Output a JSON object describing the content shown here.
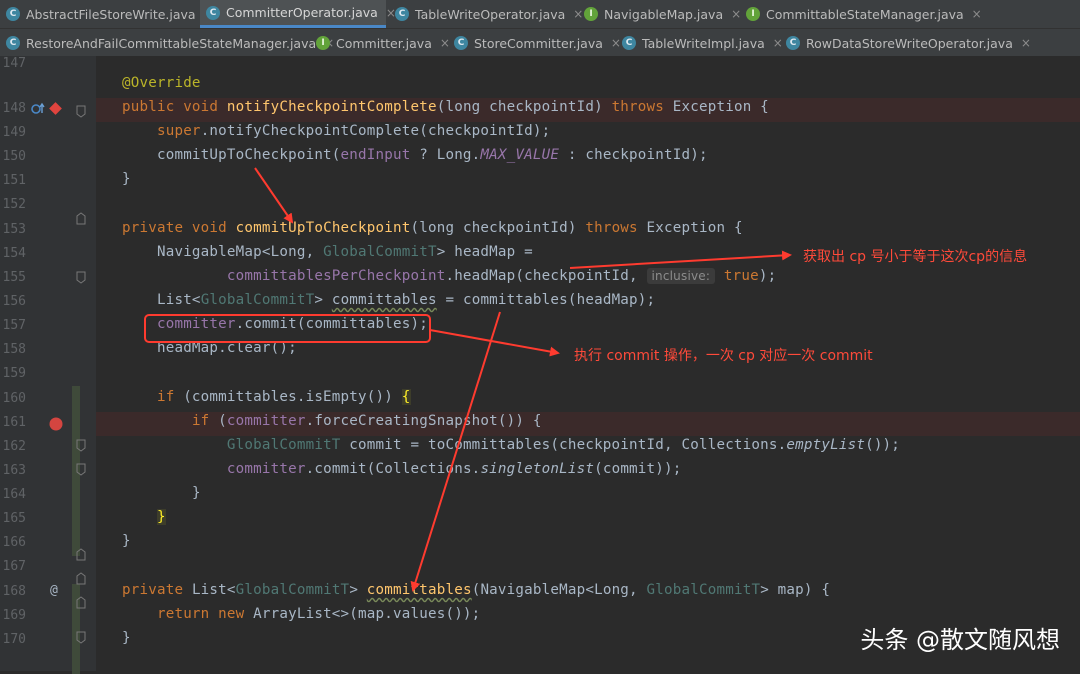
{
  "tabs_row1": [
    {
      "label": "AbstractFileStoreWrite.java",
      "icon": "c",
      "active": false
    },
    {
      "label": "CommitterOperator.java",
      "icon": "c",
      "active": true
    },
    {
      "label": "TableWriteOperator.java",
      "icon": "c",
      "active": false
    },
    {
      "label": "NavigableMap.java",
      "icon": "i",
      "active": false
    },
    {
      "label": "CommittableStateManager.java",
      "icon": "i",
      "active": false
    }
  ],
  "tabs_row2": [
    {
      "label": "RestoreAndFailCommittableStateManager.java",
      "icon": "c",
      "active": false
    },
    {
      "label": "Committer.java",
      "icon": "i",
      "active": false
    },
    {
      "label": "StoreCommitter.java",
      "icon": "c",
      "active": false
    },
    {
      "label": "TableWriteImpl.java",
      "icon": "c",
      "active": false
    },
    {
      "label": "RowDataStoreWriteOperator.java",
      "icon": "c",
      "active": false
    }
  ],
  "line_numbers": [
    "147",
    "148",
    "149",
    "150",
    "151",
    "152",
    "153",
    "154",
    "155",
    "156",
    "157",
    "158",
    "159",
    "160",
    "161",
    "162",
    "163",
    "164",
    "165",
    "166",
    "167",
    "168",
    "169",
    "170"
  ],
  "code": {
    "l147": "@Override",
    "l148": [
      "public void ",
      "notifyCheckpointComplete",
      "(long checkpointId) ",
      "throws",
      " Exception {"
    ],
    "l149": [
      "super",
      ".notifyCheckpointComplete(checkpointId);"
    ],
    "l150": [
      "commitUpToCheckpoint(",
      "endInput",
      " ? Long.",
      "MAX_VALUE",
      " : checkpointId);"
    ],
    "l151": "}",
    "l153": [
      "private void ",
      "commitUpToCheckpoint",
      "(long checkpointId) ",
      "throws",
      " Exception {"
    ],
    "l154": [
      "NavigableMap<Long, ",
      "GlobalCommitT",
      "> headMap ="
    ],
    "l155": [
      "committablesPerCheckpoint",
      ".headMap(checkpointId, ",
      "inclusive:",
      " true",
      ");"
    ],
    "l156": [
      "List<",
      "GlobalCommitT",
      "> ",
      "committables",
      " = committables(headMap);"
    ],
    "l157": [
      "committer",
      ".commit(committables);"
    ],
    "l158": "headMap.clear();",
    "l160": [
      "if",
      " (committables.isEmpty()) ",
      "{"
    ],
    "l161": [
      "if",
      " (",
      "committer",
      ".forceCreatingSnapshot()) {"
    ],
    "l162": [
      "GlobalCommitT",
      " commit = toCommittables(checkpointId, Collections.",
      "emptyList",
      "());"
    ],
    "l163": [
      "committer",
      ".commit(Collections.",
      "singletonList",
      "(commit));"
    ],
    "l164": "}",
    "l165": "}",
    "l166": "}",
    "l168": [
      "private ",
      "List<",
      "GlobalCommitT",
      "> ",
      "committables",
      "(NavigableMap<Long, ",
      "GlobalCommitT",
      "> map) {"
    ],
    "l169": [
      "return new",
      " ArrayList<>(map.values());"
    ],
    "l170": "}"
  },
  "annotations": {
    "note1": "获取出 cp 号小于等于这次cp的信息",
    "note2": "执行 commit 操作，一次 cp 对应一次 commit"
  },
  "watermark": "头条 @散文随风想",
  "colors": {
    "annotation": "#ff3b2f",
    "keyword": "#cc7832",
    "method": "#ffc66d",
    "field": "#9876aa",
    "text": "#a9b7c6"
  }
}
